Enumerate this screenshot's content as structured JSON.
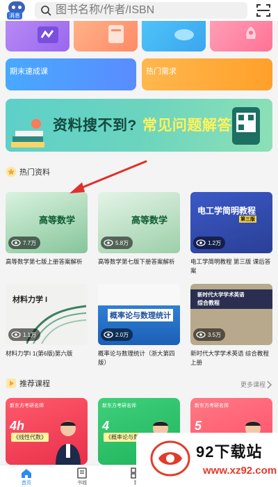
{
  "header": {
    "msg_badge": "消息",
    "search_placeholder": "图书名称/作者/ISBN"
  },
  "quick_cards": [
    {
      "label": "期末速成课"
    },
    {
      "label": "热门需求"
    }
  ],
  "banner": {
    "text1": "资料搜不到?",
    "text2": "常见问题解答"
  },
  "hot": {
    "title": "热门资料",
    "books": [
      {
        "title": "高等数学第七版上册答案解析",
        "views": "7.7万",
        "cover_title": "高等数学"
      },
      {
        "title": "高等数学第七版下册答案解析",
        "views": "5.8万",
        "cover_title": "高等数学"
      },
      {
        "title": "电工学简明教程 第三版 课后答案",
        "views": "1.2万",
        "cover_title": "电工学简明教程",
        "cover_sub": "第三版"
      },
      {
        "title": "材料力学I 1(第6版)第六版",
        "views": "1.1万",
        "cover_title": "材料力学 I"
      },
      {
        "title": "概率论与数理统计（浙大第四版）",
        "views": "2.0万",
        "cover_title": "概率论与数理统计"
      },
      {
        "title": "新时代大学学术英语 综合教程 上册",
        "views": "3.5万",
        "cover_title": "新时代大学学术英语",
        "cover_sub": "综合教程"
      }
    ]
  },
  "courses": {
    "title": "推荐课程",
    "more": "更多课程",
    "items": [
      {
        "top": "新东方考研名师",
        "big": "4h",
        "sub": "《线性代数》"
      },
      {
        "top": "新东方考研名师",
        "big": "4",
        "sub": "《概率论与数理统计》"
      },
      {
        "top": "新东方考研名师",
        "big": "5",
        "sub": ""
      }
    ]
  },
  "nav": [
    {
      "label": "首页"
    },
    {
      "label": "书城"
    },
    {
      "label": "我"
    }
  ],
  "watermark": {
    "name": "92下载站",
    "url": "www.xz92.com"
  },
  "colors": {
    "accent": "#2d8cf0",
    "arrow": "#e0302a",
    "banner_yellow": "#fff35a"
  }
}
